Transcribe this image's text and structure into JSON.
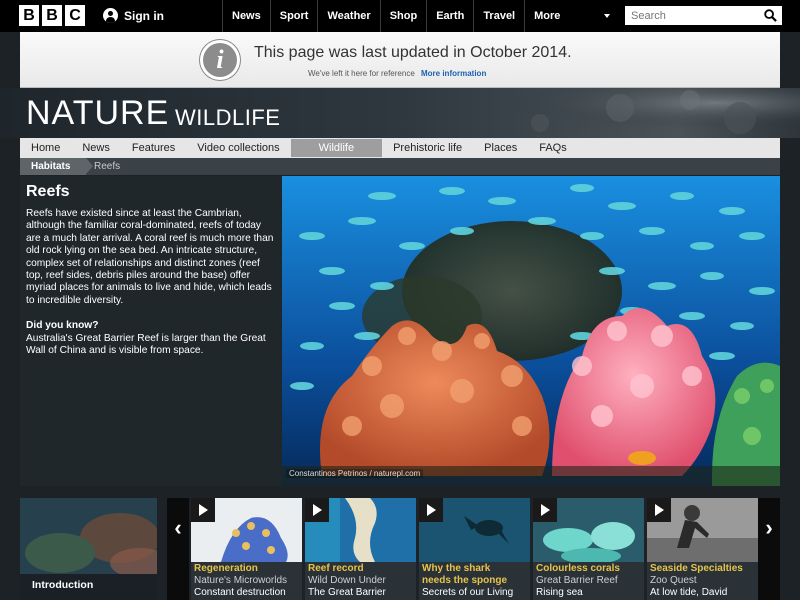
{
  "global_nav": {
    "logo": [
      "B",
      "B",
      "C"
    ],
    "signin": "Sign in",
    "items": [
      "News",
      "Sport",
      "Weather",
      "Shop",
      "Earth",
      "Travel",
      "More"
    ],
    "search_placeholder": "Search"
  },
  "notice": {
    "title": "This page was last updated in October 2014.",
    "sub": "We've left it here for reference",
    "link": "More information"
  },
  "header": {
    "brand": "NATURE",
    "section": "WILDLIFE"
  },
  "site_nav": {
    "tabs": [
      "Home",
      "News",
      "Features",
      "Video collections",
      "Wildlife",
      "Prehistoric life",
      "Places",
      "FAQs"
    ],
    "active": "Wildlife"
  },
  "breadcrumb": {
    "current_section": "Habitats",
    "page": "Reefs"
  },
  "content": {
    "title": "Reefs",
    "body": "Reefs have existed since at least the Cambrian, although the familiar coral-dominated, reefs of today are a much later arrival. A coral reef is much more than old rock lying on the sea bed. An intricate structure, complex set of relationships and distinct zones (reef top, reef sides, debris piles around the base) offer myriad places for animals to live and hide, which leads to incredible diversity.",
    "did_you_know_title": "Did you know?",
    "did_you_know_body": "Australia's Great Barrier Reef is larger than the Great Wall of China and is visible from space."
  },
  "hero": {
    "credit": "Constantinos Petrinos / naturepl.com"
  },
  "carousel": {
    "intro_label": "Introduction",
    "cards": [
      {
        "title": "Regeneration",
        "programme": "Nature's Microworlds",
        "episode": "Constant destruction"
      },
      {
        "title": "Reef record",
        "programme": "Wild Down Under",
        "episode": "The Great Barrier"
      },
      {
        "title": "Why the shark needs the sponge",
        "programme": "",
        "episode": "Secrets of our Living"
      },
      {
        "title": "Colourless corals",
        "programme": "Great Barrier Reef",
        "episode": "Rising sea"
      },
      {
        "title": "Seaside Specialties",
        "programme": "Zoo Quest",
        "episode": "At low tide, David"
      }
    ]
  },
  "colors": {
    "accent_yellow": "#e8c44a",
    "link_blue": "#1f5fb0",
    "bg_dark": "#1c2226"
  }
}
